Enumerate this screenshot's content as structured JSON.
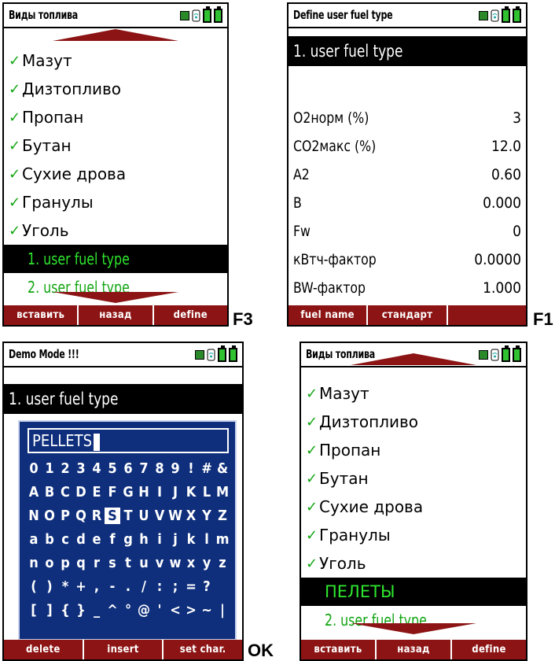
{
  "screen1": {
    "title": "Виды топлива",
    "items": [
      "Мазут",
      "Дизтопливо",
      "Пропан",
      "Бутан",
      "Сухие дрова",
      "Гранулы",
      "Уголь"
    ],
    "user_items": [
      "1. user fuel type",
      "2. user fuel type"
    ],
    "check": "✓",
    "fkeys": [
      "вставить",
      "назад",
      "define"
    ],
    "side_key": "F3"
  },
  "screen2": {
    "title": "Define user fuel type",
    "selected": "1. user fuel type",
    "params": [
      {
        "name": "O2норм (%)",
        "value": "3"
      },
      {
        "name": "CO2макс (%)",
        "value": "12.0"
      },
      {
        "name": "A2",
        "value": "0.60"
      },
      {
        "name": "B",
        "value": "0.000"
      },
      {
        "name": "Fw",
        "value": "0"
      },
      {
        "name": "кВтч-фактор",
        "value": "0.0000"
      },
      {
        "name": "BW-фактор",
        "value": "1.000"
      }
    ],
    "fkeys": [
      "fuel name",
      "стандарт",
      ""
    ],
    "side_key": "F1"
  },
  "screen3": {
    "title": "Demo Mode !!!",
    "selected": "1. user fuel type",
    "input_value": "PELLETS",
    "rows": [
      [
        "0",
        "1",
        "2",
        "3",
        "4",
        "5",
        "6",
        "7",
        "8",
        "9",
        "!",
        "#",
        "&"
      ],
      [
        "A",
        "B",
        "C",
        "D",
        "E",
        "F",
        "G",
        "H",
        "I",
        "J",
        "K",
        "L",
        "M"
      ],
      [
        "N",
        "O",
        "P",
        "Q",
        "R",
        "S",
        "T",
        "U",
        "V",
        "W",
        "X",
        "Y",
        "Z"
      ],
      [
        "a",
        "b",
        "c",
        "d",
        "e",
        "f",
        "g",
        "h",
        "i",
        "j",
        "k",
        "l",
        "m"
      ],
      [
        "n",
        "o",
        "p",
        "q",
        "r",
        "s",
        "t",
        "u",
        "v",
        "w",
        "x",
        "y",
        "z"
      ],
      [
        "(",
        ")",
        "*",
        "+",
        ",",
        "-",
        ".",
        "/",
        ":",
        ";",
        "=",
        "?",
        ""
      ],
      [
        "[",
        "]",
        "{",
        "}",
        "_",
        "^",
        "°",
        "@",
        "'",
        "<",
        ">",
        "~",
        "|"
      ]
    ],
    "highlight": "S",
    "fkeys": [
      "delete",
      "insert",
      "set char."
    ],
    "side_key": "OK"
  },
  "screen4": {
    "title": "Виды топлива",
    "items": [
      "Мазут",
      "Дизтопливо",
      "Пропан",
      "Бутан",
      "Сухие дрова",
      "Гранулы",
      "Уголь"
    ],
    "selected_item": "ПЕЛЕТЫ",
    "user_item": "2. user fuel type",
    "check": "✓",
    "fkeys": [
      "вставить",
      "назад",
      "define"
    ]
  },
  "colors": {
    "fkey_bg": "#8c1414",
    "check": "#11a511",
    "keyboard_bg": "#0f2f7c"
  }
}
